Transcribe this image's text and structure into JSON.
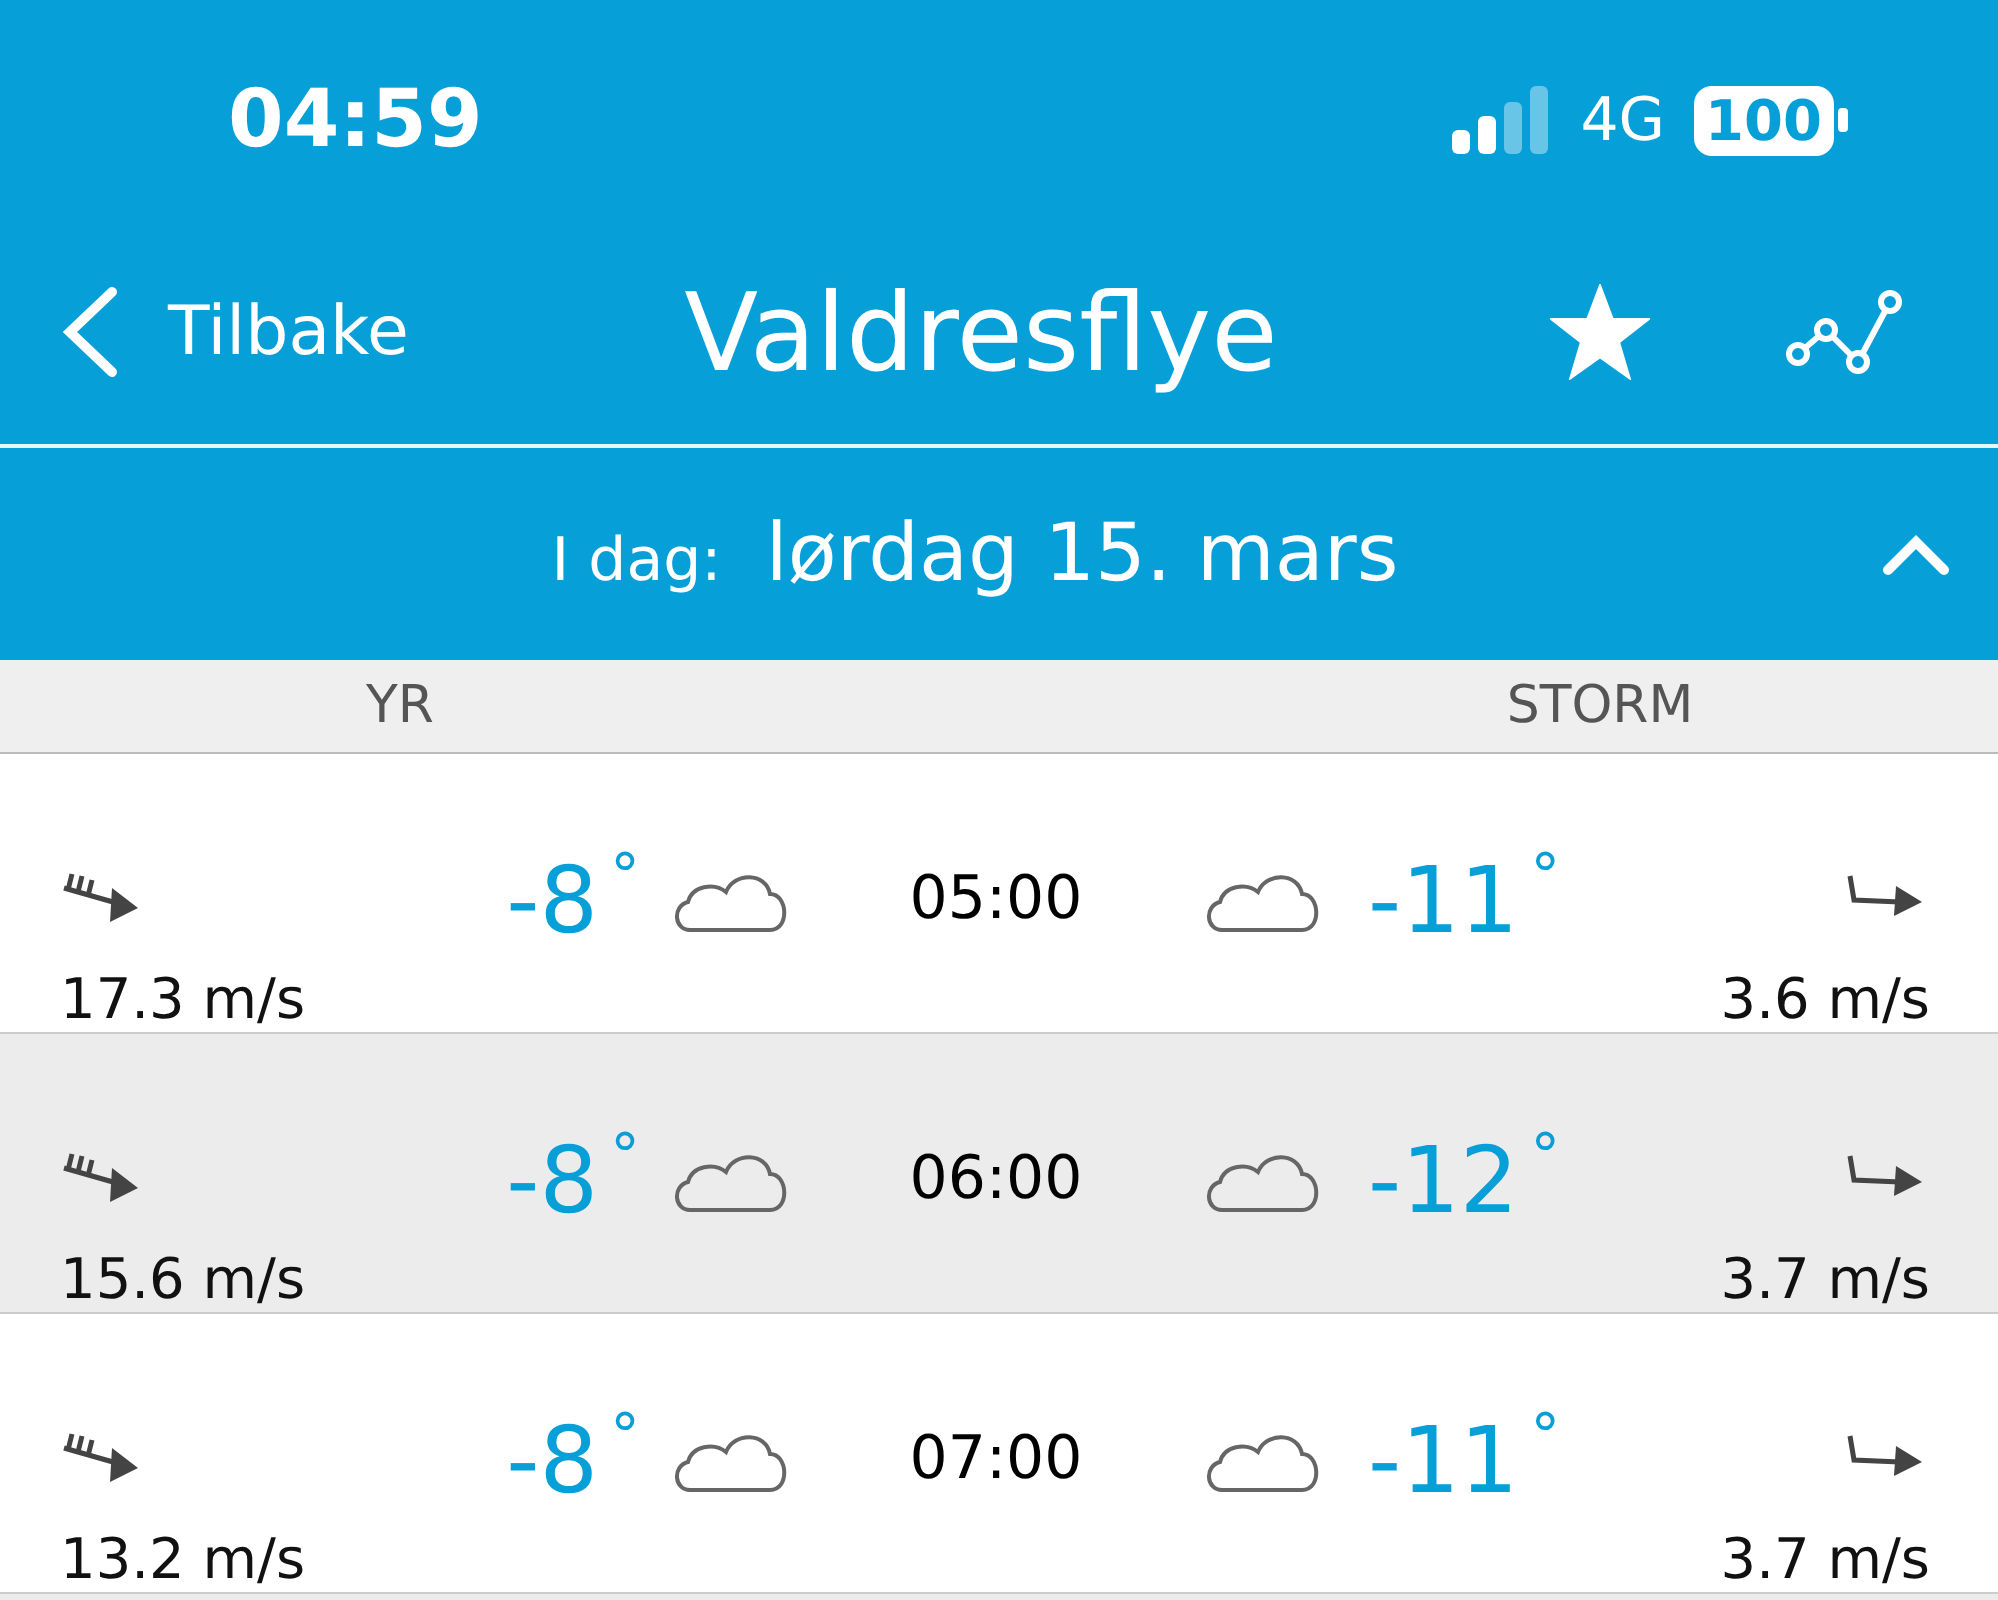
{
  "status_bar": {
    "time": "04:59",
    "network": "4G",
    "battery": "100"
  },
  "nav": {
    "back": "Tilbake",
    "title": "Valdresflye",
    "favorite": true
  },
  "date_bar": {
    "label": "I dag:",
    "date": "lørdag 15. mars",
    "expanded": true
  },
  "columns": [
    "YR",
    "STORM"
  ],
  "rows": [
    {
      "time": "05:00",
      "left_temp": "-8$^{°}$",
      "left_wind": "17.3 m/s",
      "right_temp": "-11$^{°}$",
      "right_wind": "3.6 m/s"
    },
    {
      "time": "06:00",
      "left_temp": "-8$^{°}$",
      "left_wind": "15.6 m/s",
      "right_temp": "-12$^{°}$",
      "right_wind": "3.7 m/s"
    },
    {
      "time": "07:00",
      "left_temp": "-8$^{°}$",
      "left_wind": "13.2 m/s",
      "right_temp": "-11$^{°}$",
      "right_wind": "3.7 m/s"
    }
  ]
}
